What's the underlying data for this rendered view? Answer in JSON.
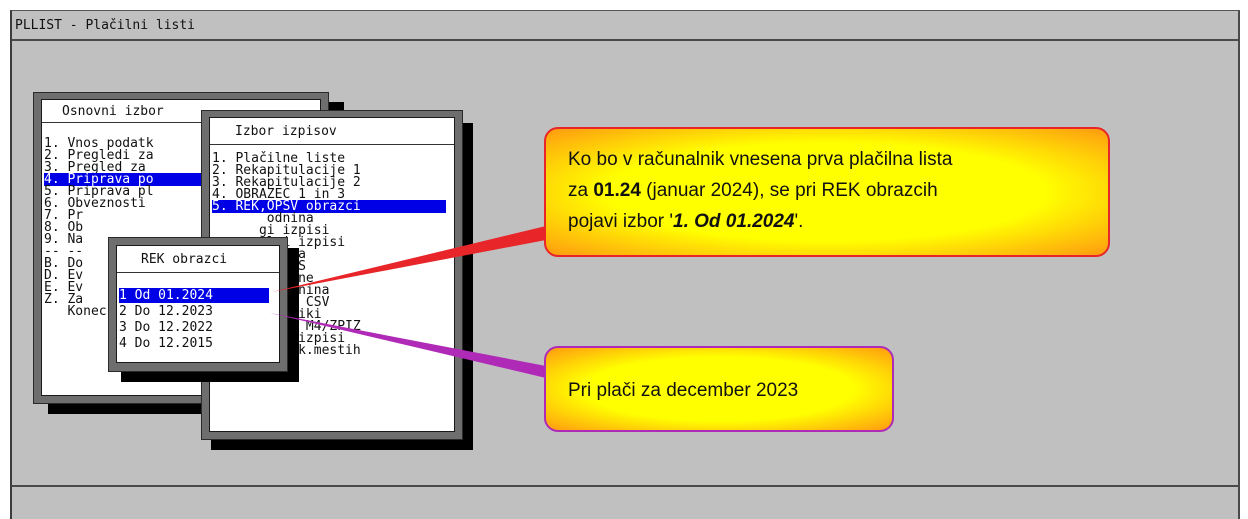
{
  "window": {
    "title": "PLLIST - Plačilni listi"
  },
  "main_menu": {
    "title": "Osnovni izbor",
    "items": [
      "1. Vnos podatk",
      "2. Pregledi za",
      "3. Pregled za",
      "4. Priprava po",
      "5. Priprava pl",
      "6. Obveznosti",
      "7. Pr",
      "8. Ob",
      "9. Na",
      "-- --",
      "B. Do",
      "D. Ev",
      "E. Ev",
      "Z. Za",
      "   Konec"
    ],
    "selected_index": 3
  },
  "reports_menu": {
    "title": "Izbor izpisov",
    "items": [
      "1. Plačilne liste",
      "2. Rekapitulacije 1",
      "3. Rekapitulacije 2",
      "4. OBRAZEC 1 in 3",
      "5. REK,OPSV obrazci",
      "       odnina",
      "      gi izpisi",
      "      alni izpisi",
      "       ojila",
      "       AJPES",
      "       ežnine",
      "       alidnina",
      "       el / CSV",
      "K. Kontrolniki",
      "R. Revizija M4/ZPIZ",
      "P. Posebni izpisi",
      "S. Po strošk.mestih"
    ],
    "selected_index": 4
  },
  "rek_menu": {
    "title": "REK obrazci",
    "items": [
      "1 Od 01.2024",
      "2 Do 12.2023",
      "3 Do 12.2022",
      "4 Do 12.2015"
    ],
    "selected_index": 0
  },
  "callouts": {
    "red": {
      "line1": "Ko bo v računalnik vnesena prva plačilna lista",
      "line2_pre": "za ",
      "line2_bold": "01.24",
      "line2_post": " (januar 2024), se pri REK obrazcih",
      "line3_pre": "pojavi izbor '",
      "line3_bold": "1. Od 01.2024",
      "line3_post": "'.",
      "border_color": "#e8262a"
    },
    "purple": {
      "text": "Pri plači za december 2023",
      "border_color": "#b02ab8"
    }
  }
}
